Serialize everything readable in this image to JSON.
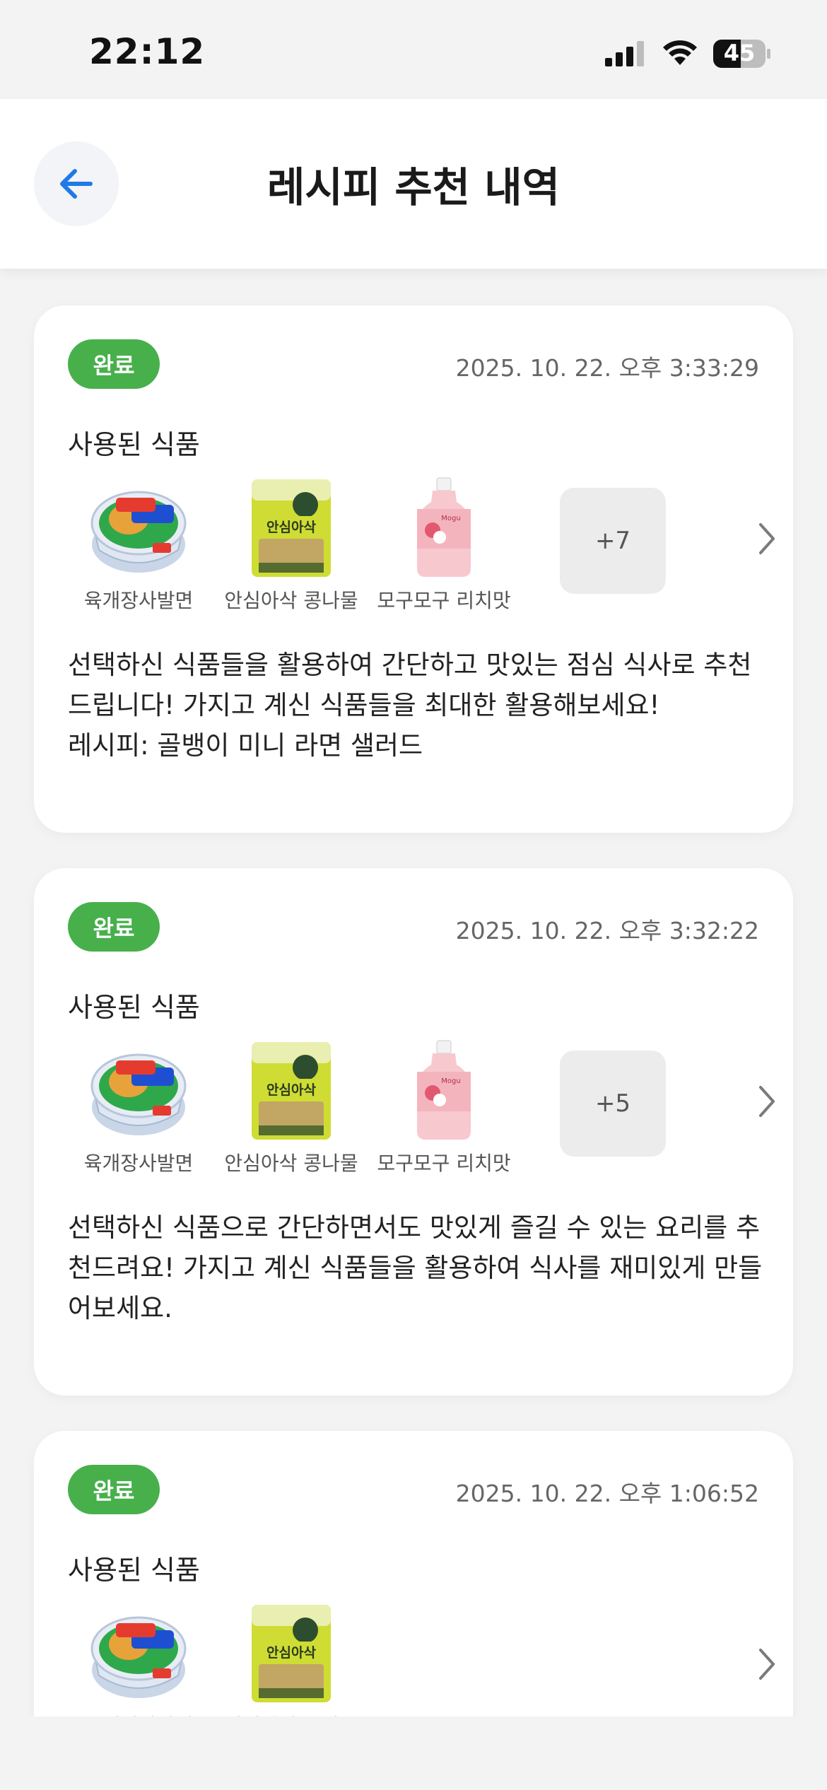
{
  "status_bar": {
    "time": "22:12",
    "battery": "45",
    "icons": [
      "signal-icon",
      "wifi-icon",
      "battery-icon"
    ]
  },
  "header": {
    "back_icon": "arrow-left-icon",
    "title": "레시피 추천 내역"
  },
  "colors": {
    "accent": "#1f7ae6",
    "badge_green": "#47b04b",
    "background": "#f3f3f3"
  },
  "cards": [
    {
      "status": "완료",
      "timestamp": "2025. 10. 22. 오후 3:33:29",
      "section_label": "사용된 식품",
      "foods": [
        {
          "name": "육개장사발면",
          "icon": "ramen-cup-icon"
        },
        {
          "name": "안심아삭 콩나물",
          "icon": "bean-sprout-bag-icon"
        },
        {
          "name": "모구모구 리치맛",
          "icon": "drink-bottle-icon"
        }
      ],
      "more": "+7",
      "description": [
        "선택하신 식품들을 활용하여 간단하고 맛있는 점심 식사로 추천드립니다! 가지고 계신 식품들을 최대한 활용해보세요!",
        "레시피: 골뱅이 미니 라면 샐러드"
      ]
    },
    {
      "status": "완료",
      "timestamp": "2025. 10. 22. 오후 3:32:22",
      "section_label": "사용된 식품",
      "foods": [
        {
          "name": "육개장사발면",
          "icon": "ramen-cup-icon"
        },
        {
          "name": "안심아삭 콩나물",
          "icon": "bean-sprout-bag-icon"
        },
        {
          "name": "모구모구 리치맛",
          "icon": "drink-bottle-icon"
        }
      ],
      "more": "+5",
      "description": [
        "선택하신 식품으로 간단하면서도 맛있게 즐길 수 있는 요리를 추천드려요! 가지고 계신 식품들을 활용하여 식사를 재미있게 만들어보세요."
      ]
    },
    {
      "status": "완료",
      "timestamp": "2025. 10. 22. 오후 1:06:52",
      "section_label": "사용된 식품",
      "foods": [
        {
          "name": "육개장사발면",
          "icon": "ramen-cup-icon"
        },
        {
          "name": "안심아삭 콩나물",
          "icon": "bean-sprout-bag-icon"
        }
      ]
    }
  ]
}
